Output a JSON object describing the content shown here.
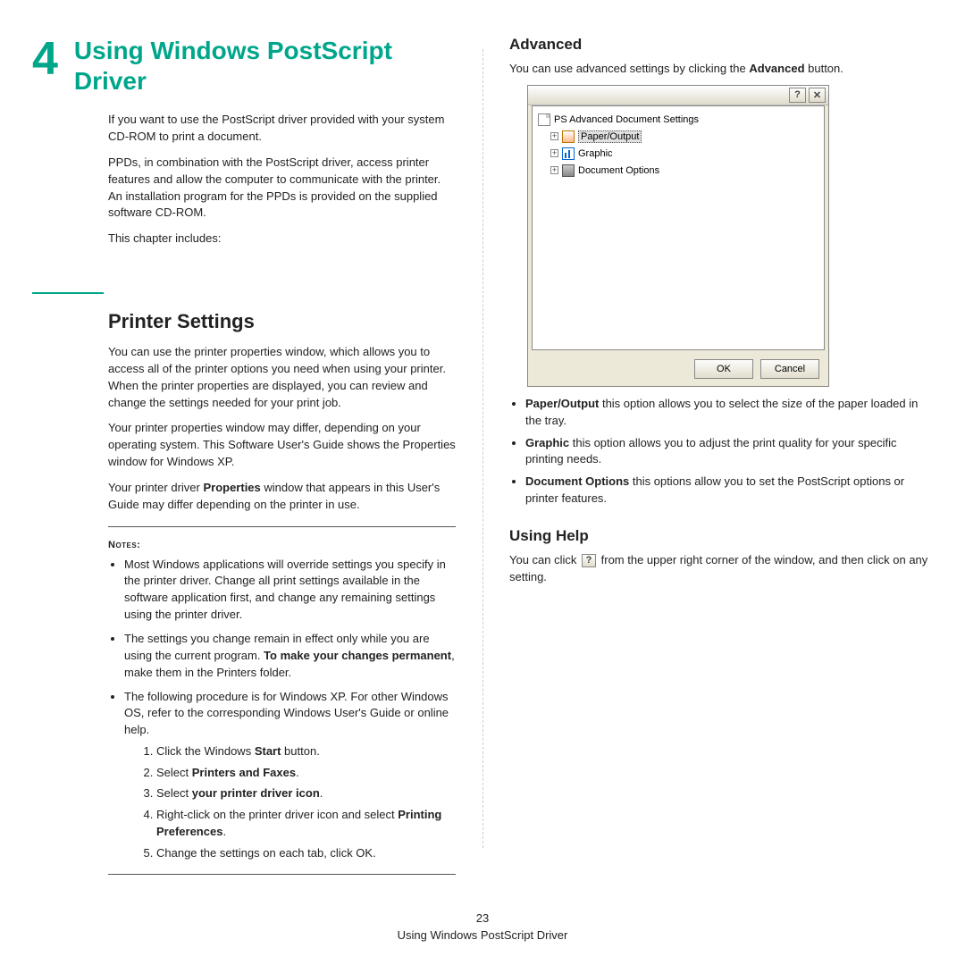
{
  "chapter": {
    "number": "4",
    "title": "Using Windows PostScript Driver"
  },
  "intro": {
    "p1": "If you want to use the PostScript driver provided with your system CD-ROM to print a document.",
    "p2": "PPDs, in combination with the PostScript driver, access printer features and allow the computer to communicate with the printer. An installation program for the PPDs is provided on the supplied software CD-ROM.",
    "p3": "This chapter includes:"
  },
  "printer_settings": {
    "title": "Printer Settings",
    "p1": "You can use the printer properties window, which allows you to access all of the printer options you need when using your printer. When the printer properties are displayed, you can review and change the settings needed for your print job.",
    "p2": "Your printer properties window may differ, depending on your operating system. This Software User's Guide shows the Properties window for Windows XP.",
    "p3_pre": "Your printer driver ",
    "p3_bold": "Properties",
    "p3_post": " window that appears in this User's Guide may differ depending on the printer in use.",
    "notes_label": "Notes",
    "notes": [
      "Most Windows applications will override settings you specify in the printer driver. Change all print settings available in the software application first, and change any remaining settings using the printer driver."
    ],
    "note2_pre": "The settings you change remain in effect only while you are using the current program. ",
    "note2_bold": "To make your changes permanent",
    "note2_post": ", make them in the Printers folder.",
    "note3": "The following procedure is for Windows XP. For other Windows OS, refer to the corresponding Windows User's Guide or online help.",
    "steps": {
      "s1_pre": "Click the Windows ",
      "s1_bold": "Start",
      "s1_post": " button.",
      "s2_pre": "Select ",
      "s2_bold": "Printers and Faxes",
      "s2_post": ".",
      "s3_pre": "Select ",
      "s3_bold": "your printer driver icon",
      "s3_post": ".",
      "s4_pre": "Right-click on the printer driver icon and select ",
      "s4_bold": "Printing Preferences",
      "s4_post": ".",
      "s5": "Change the settings on each tab, click OK."
    }
  },
  "advanced": {
    "title": "Advanced",
    "intro_pre": "You can use advanced settings by clicking the ",
    "intro_bold": "Advanced",
    "intro_post": " button.",
    "tree": {
      "root": "PS Advanced Document Settings",
      "paper": "Paper/Output",
      "graphic": "Graphic",
      "docopts": "Document Options"
    },
    "buttons": {
      "ok": "OK",
      "cancel": "Cancel",
      "help": "?",
      "close": "✕"
    },
    "opts": {
      "o1_bold": "Paper/Output",
      "o1_post": " this option allows you to select the size of the paper loaded in the tray.",
      "o2_bold": "Graphic",
      "o2_post": " this option allows you to adjust the print quality for your specific printing needs.",
      "o3_bold": "Document Options",
      "o3_post": " this options allow you to set the PostScript options or printer features."
    }
  },
  "using_help": {
    "title": "Using Help",
    "pre": "You can click ",
    "post": " from the upper right corner of the window, and then click on any setting.",
    "icon": "?"
  },
  "footer": {
    "page": "23",
    "text": "Using Windows PostScript Driver"
  }
}
